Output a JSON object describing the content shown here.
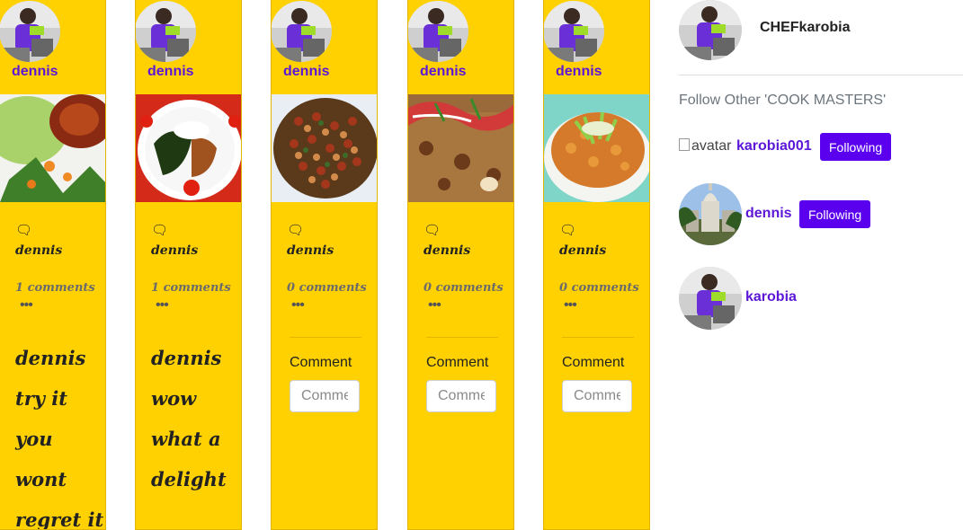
{
  "feed": [
    {
      "username": "dennis",
      "comment_user": "dennis",
      "comment_count": "1 comments",
      "caption_lines": [
        "dennis",
        "try it",
        "you wont",
        "regret it"
      ],
      "comment_label": "",
      "comment_placeholder": ""
    },
    {
      "username": "dennis",
      "comment_user": "dennis",
      "comment_count": "1 comments",
      "caption_lines": [
        "dennis",
        "wow",
        "what a",
        "delight"
      ],
      "comment_label": "",
      "comment_placeholder": ""
    },
    {
      "username": "dennis",
      "comment_user": "dennis",
      "comment_count": "0 comments",
      "caption_lines": [],
      "comment_label": "Comment",
      "comment_placeholder": "Comment"
    },
    {
      "username": "dennis",
      "comment_user": "dennis",
      "comment_count": "0 comments",
      "caption_lines": [],
      "comment_label": "Comment",
      "comment_placeholder": "Comment"
    },
    {
      "username": "dennis",
      "comment_user": "dennis",
      "comment_count": "0 comments",
      "caption_lines": [],
      "comment_label": "Comment",
      "comment_placeholder": "Comment"
    }
  ],
  "sidebar": {
    "current_user": "CHEFkarobia",
    "follow_heading": "Follow Other 'COOK MASTERS'",
    "users": [
      {
        "name": "karobia001",
        "avatar_alt": "avatar",
        "button": "Following"
      },
      {
        "name": "dennis",
        "button": "Following"
      },
      {
        "name": "karobia",
        "button": ""
      }
    ]
  },
  "icons": {
    "comment": "speech-bubble-icon",
    "more": "more-dots-icon"
  },
  "colors": {
    "card": "#ffd100",
    "accent": "#5b16d8",
    "button": "#5b00ef"
  }
}
